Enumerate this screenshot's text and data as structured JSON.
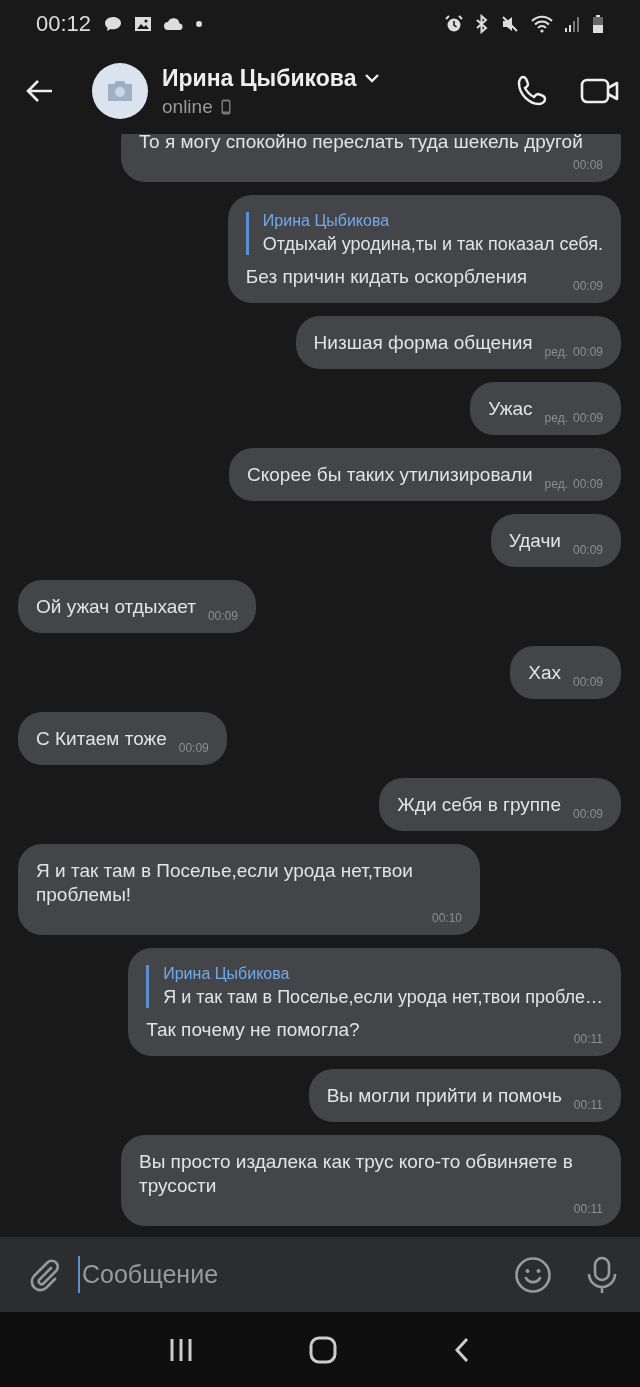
{
  "status_bar": {
    "time": "00:12"
  },
  "header": {
    "name": "Ирина Цыбикова",
    "status": "online"
  },
  "messages": [
    {
      "outgoing": true,
      "text": "То я могу спокойно переслать туда шекель другой",
      "time": "00:08"
    },
    {
      "outgoing": true,
      "text": "Без причин кидать оскорбления",
      "time": "00:09",
      "reply": {
        "author": "Ирина Цыбикова",
        "text": "Отдыхай уродина,ты и так показал себя."
      }
    },
    {
      "outgoing": true,
      "text": "Низшая форма общения",
      "time": "00:09",
      "edited": "ред."
    },
    {
      "outgoing": true,
      "text": "Ужас",
      "time": "00:09",
      "edited": "ред."
    },
    {
      "outgoing": true,
      "text": "Скорее бы таких утилизировали",
      "time": "00:09",
      "edited": "ред."
    },
    {
      "outgoing": true,
      "text": "Удачи",
      "time": "00:09"
    },
    {
      "outgoing": false,
      "text": "Ой ужач отдыхает",
      "time": "00:09"
    },
    {
      "outgoing": true,
      "text": "Хах",
      "time": "00:09"
    },
    {
      "outgoing": false,
      "text": "С Китаем тоже",
      "time": "00:09"
    },
    {
      "outgoing": true,
      "text": "Жди себя в группе",
      "time": "00:09"
    },
    {
      "outgoing": false,
      "text": "Я и так там в Поселье,если урода нет,твои проблемы!",
      "time": "00:10"
    },
    {
      "outgoing": true,
      "text": "Так почему не помогла?",
      "time": "00:11",
      "reply": {
        "author": "Ирина Цыбикова",
        "text": "Я и так там в Поселье,если урода нет,твои пробле…"
      }
    },
    {
      "outgoing": true,
      "text": "Вы могли прийти и помочь",
      "time": "00:11"
    },
    {
      "outgoing": true,
      "text": "Вы просто издалека как трус кого-то обвиняете в трусости",
      "time": "00:11"
    }
  ],
  "composer": {
    "placeholder": "Сообщение"
  }
}
